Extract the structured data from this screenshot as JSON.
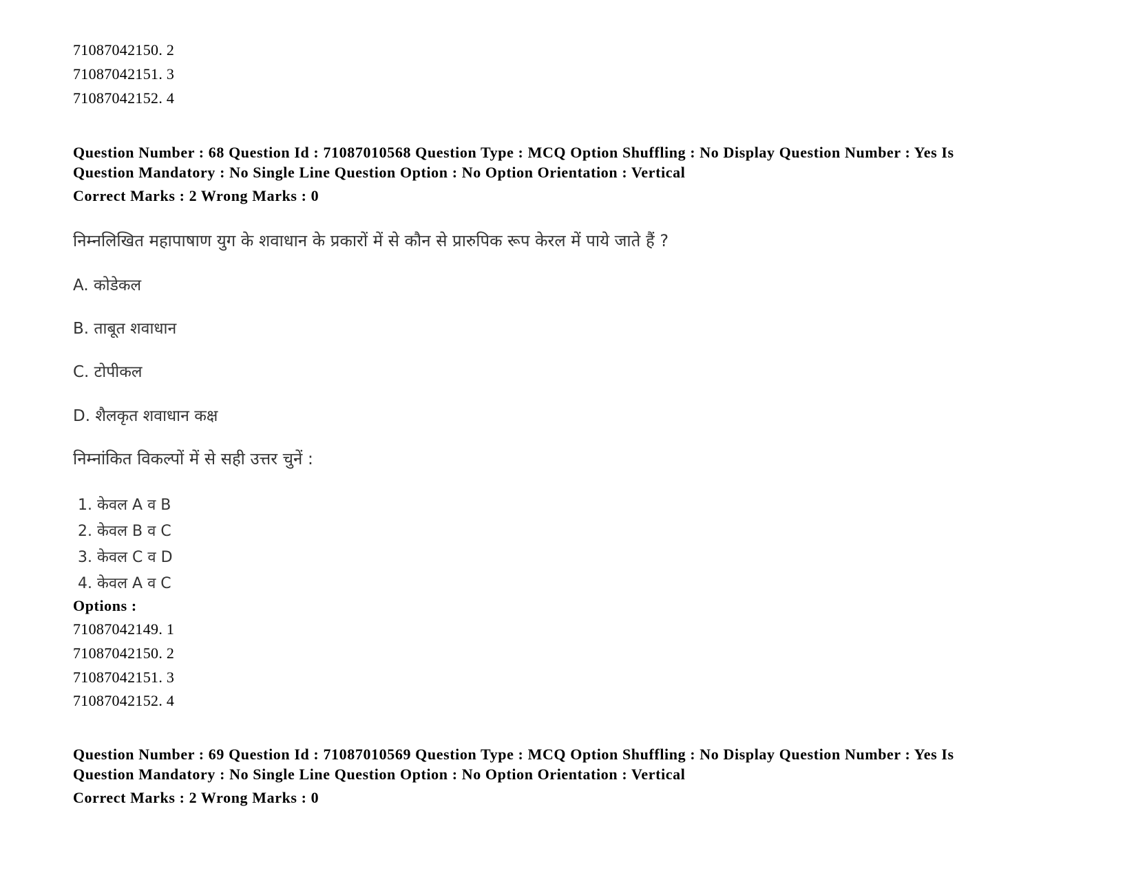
{
  "prev_question_options_tail": [
    {
      "id": "71087042150",
      "value": "2"
    },
    {
      "id": "71087042151",
      "value": "3"
    },
    {
      "id": "71087042152",
      "value": "4"
    }
  ],
  "question_68": {
    "meta_line1": "Question Number : 68 Question Id : 71087010568 Question Type : MCQ Option Shuffling : No Display Question Number : Yes Is",
    "meta_line2": "Question Mandatory : No Single Line Question Option : No Option Orientation : Vertical",
    "marks": "Correct Marks : 2 Wrong Marks : 0",
    "question_text": "निम्नलिखित महापाषाण युग के शवाधान के प्रकारों में से कौन से प्रारुपिक रूप केरल में पाये जाते हैं ?",
    "statements": [
      "A. कोडेकल",
      "B. ताबूत शवाधान",
      "C. टोपीकल",
      "D. शैलकृत शवाधान कक्ष"
    ],
    "instruction": "निम्नांकित विकल्पों में से सही उत्तर चुनें :",
    "choices": [
      "1. केवल A व B",
      "2. केवल B व C",
      "3. केवल C व D",
      "4. केवल A व C"
    ],
    "options_label": "Options :",
    "options": [
      {
        "id": "71087042149",
        "value": "1"
      },
      {
        "id": "71087042150",
        "value": "2"
      },
      {
        "id": "71087042151",
        "value": "3"
      },
      {
        "id": "71087042152",
        "value": "4"
      }
    ]
  },
  "question_69": {
    "meta_line1": "Question Number : 69 Question Id : 71087010569 Question Type : MCQ Option Shuffling : No Display Question Number : Yes Is",
    "meta_line2": "Question Mandatory : No Single Line Question Option : No Option Orientation : Vertical",
    "marks": "Correct Marks : 2 Wrong Marks : 0"
  }
}
